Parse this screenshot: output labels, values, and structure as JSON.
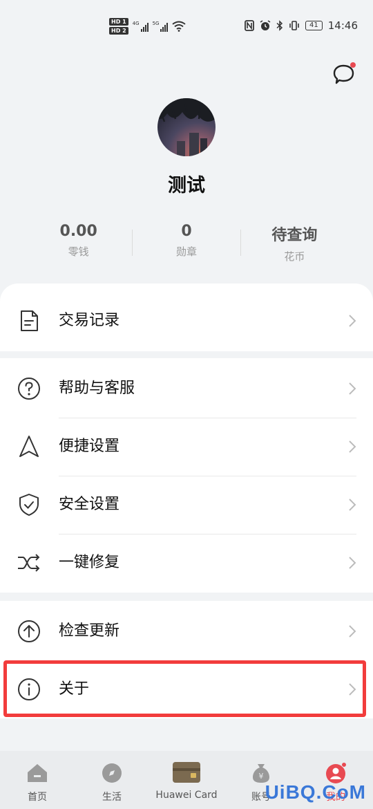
{
  "status_bar": {
    "hd1": "HD 1",
    "hd2": "HD 2",
    "net1": "4G",
    "net2": "5G",
    "battery": "41",
    "time": "14:46"
  },
  "profile": {
    "name": "测试"
  },
  "stats": [
    {
      "value": "0.00",
      "label": "零钱"
    },
    {
      "value": "0",
      "label": "勋章"
    },
    {
      "value": "待查询",
      "label": "花币"
    }
  ],
  "menu": {
    "transactions": "交易记录",
    "help": "帮助与客服",
    "shortcut": "便捷设置",
    "security": "安全设置",
    "repair": "一键修复",
    "update": "检查更新",
    "about": "关于"
  },
  "bottom_nav": [
    {
      "label": "首页"
    },
    {
      "label": "生活"
    },
    {
      "label": "Huawei Card"
    },
    {
      "label": "账号"
    },
    {
      "label": "我的"
    }
  ],
  "watermark": "UiBQ.CoM",
  "colors": {
    "accent": "#e84a52",
    "highlight": "#f23c3c",
    "background": "#f1f3f5"
  }
}
